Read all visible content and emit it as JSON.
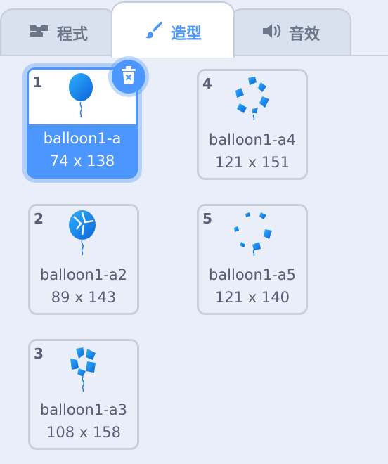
{
  "tabs": {
    "code": {
      "label": "程式",
      "icon": "code-icon"
    },
    "costumes": {
      "label": "造型",
      "icon": "paintbrush-icon"
    },
    "sounds": {
      "label": "音效",
      "icon": "speaker-icon"
    }
  },
  "colors": {
    "accent": "#4c97ff",
    "text": "#575e75",
    "background": "#e9eef8"
  },
  "costumes": [
    {
      "number": "1",
      "name": "balloon1-a",
      "size": "74 x 138",
      "selected": true
    },
    {
      "number": "2",
      "name": "balloon1-a2",
      "size": "89 x 143",
      "selected": false
    },
    {
      "number": "3",
      "name": "balloon1-a3",
      "size": "108 x 158",
      "selected": false
    },
    {
      "number": "4",
      "name": "balloon1-a4",
      "size": "121 x 151",
      "selected": false
    },
    {
      "number": "5",
      "name": "balloon1-a5",
      "size": "121 x 140",
      "selected": false
    }
  ]
}
